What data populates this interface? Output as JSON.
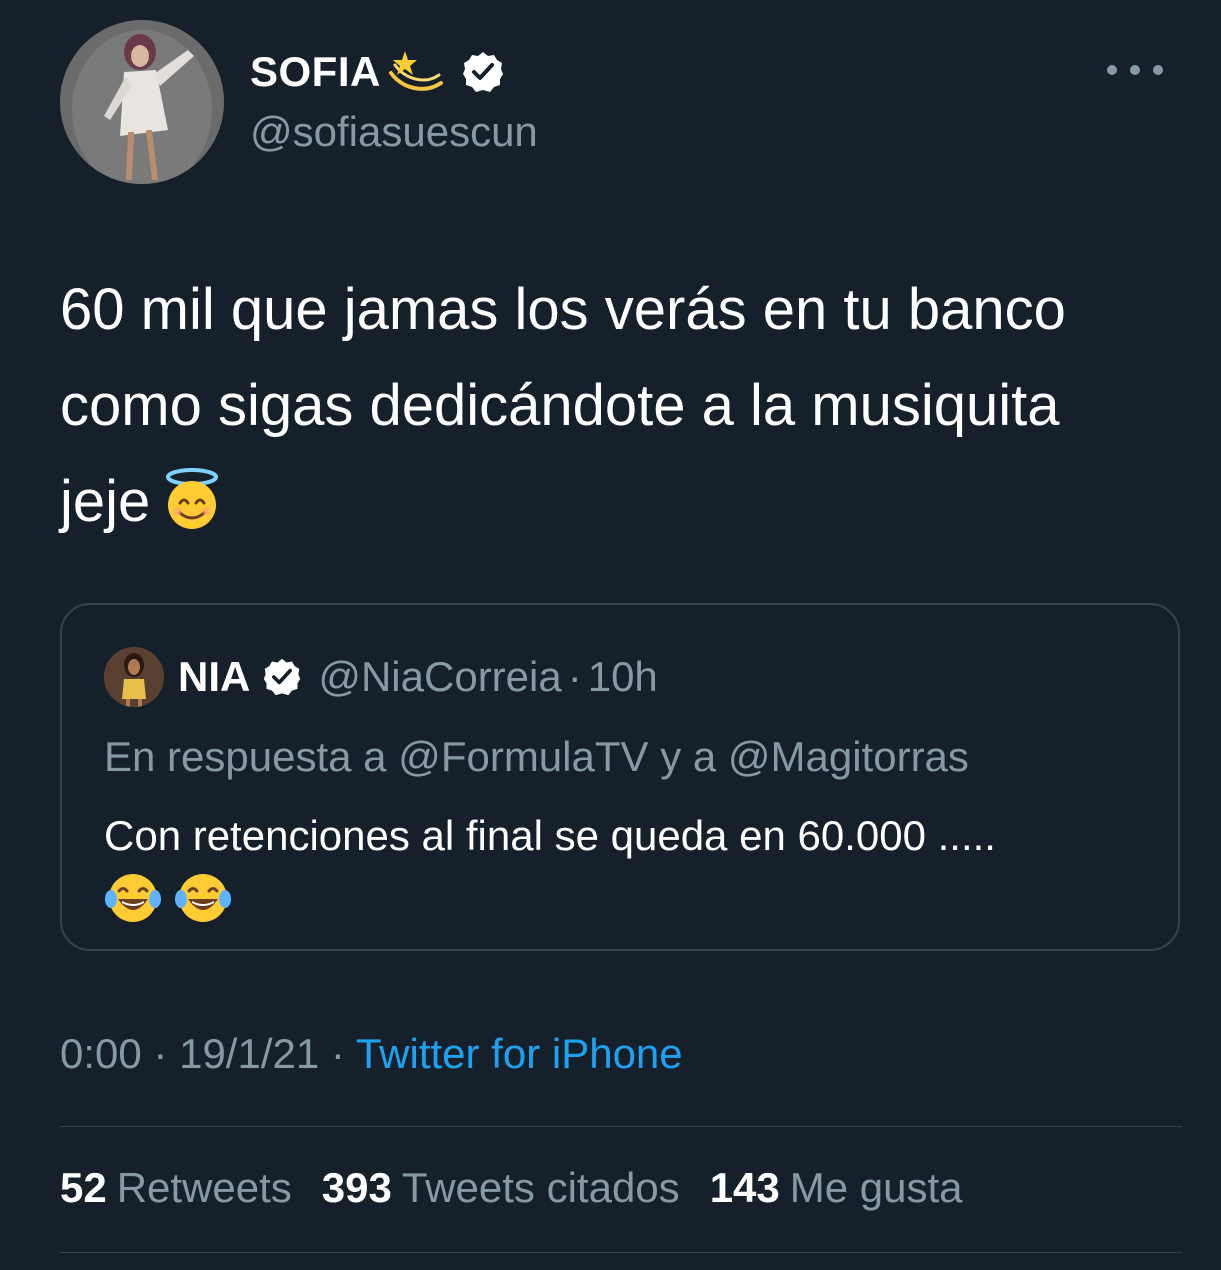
{
  "author": {
    "display_name": "SOFIA",
    "name_emoji": "shooting-star-icon",
    "verified": true,
    "handle": "@sofiasuescun"
  },
  "tweet": {
    "text": "60 mil que jamas los verás en tu banco como sigas dedicándote a la musiquita jeje",
    "emoji": "smiling-face-with-halo-icon"
  },
  "quoted_tweet": {
    "name": "NIA",
    "verified": true,
    "handle": "@NiaCorreia",
    "separator": "·",
    "time": "10h",
    "reply_context": "En respuesta a @FormulaTV y a @Magitorras",
    "text": "Con retenciones al final se queda en 60.000 .....",
    "emojis": [
      "face-with-tears-of-joy-icon",
      "face-with-tears-of-joy-icon"
    ]
  },
  "meta": {
    "time": "0:00",
    "sep1": "·",
    "date": "19/1/21",
    "sep2": "·",
    "source": "Twitter for iPhone"
  },
  "stats": {
    "retweets_count": "52",
    "retweets_label": "Retweets",
    "quotes_count": "393",
    "quotes_label": "Tweets citados",
    "likes_count": "143",
    "likes_label": "Me gusta"
  },
  "colors": {
    "background": "#15202b",
    "secondary_text": "#8899a6",
    "link": "#1da1f2",
    "border": "#38444d"
  }
}
